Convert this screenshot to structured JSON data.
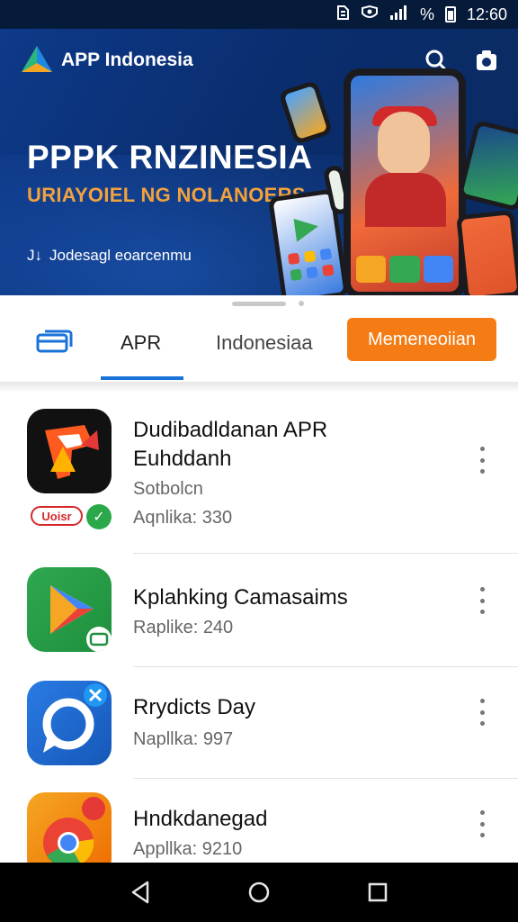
{
  "status_bar": {
    "time": "12:60",
    "battery_percent_label": "%"
  },
  "header": {
    "app_name": "APP Indonesia"
  },
  "banner": {
    "headline": "PPPK RNZINESIA",
    "subline": "URIAYOIEL NG NOLANOERS",
    "caption": "Jodesagl eoarcenmu",
    "caption_icon": "J↓"
  },
  "tabs": {
    "items": [
      {
        "label": "APR",
        "active": true
      },
      {
        "label": "Indonesiaa",
        "active": false
      }
    ],
    "cta_label": "Memeneoiian"
  },
  "apps": [
    {
      "title_line1": "Dudibadldanan APR",
      "title_line2": "Euhddanh",
      "subtitle": "Sotbolcn",
      "meta": "Aqnlika: 330",
      "badge_label": "Uoisr",
      "badge_check": "✓"
    },
    {
      "title_line1": "Kplahking Camasaims",
      "meta": "Raplike: 240",
      "icon_badge": "bd"
    },
    {
      "title_line1": "Rrydicts Day",
      "meta": "Napllka: 997",
      "icon_badge": "✕"
    },
    {
      "title_line1": "Hndkdanegad",
      "meta": "Appllka: 9210",
      "icon_badge": "%"
    }
  ],
  "colors": {
    "brand_blue": "#0a2d6e",
    "accent_orange": "#f57c14",
    "tab_active": "#1a73d9"
  },
  "icons": [
    "search-icon",
    "camera-icon",
    "back-icon",
    "home-icon",
    "recents-icon",
    "more-vert-icon"
  ]
}
